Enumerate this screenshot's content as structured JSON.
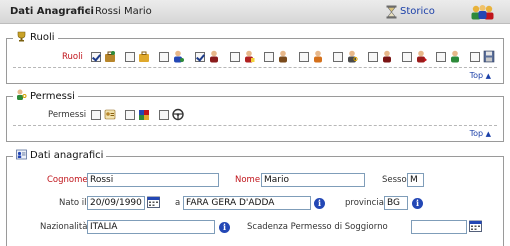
{
  "header": {
    "section_title": "Dati Anagrafici",
    "separator": "-",
    "person_name": "Rossi Mario",
    "storico_label": "Storico"
  },
  "ruoli": {
    "legend": "Ruoli",
    "row_label": "Ruoli",
    "top_label": "Top",
    "checkboxes": [
      true,
      false,
      false,
      false,
      true,
      false,
      false,
      false,
      false,
      false,
      false,
      false,
      false,
      false
    ],
    "icons": [
      "briefcase-icon",
      "briefcase-gold-icon",
      "person-blue-icon",
      "person-red-icon",
      "person-red-badge-icon",
      "person-brown-icon",
      "person-orange-icon",
      "person-key-icon",
      "person-dark-icon",
      "person-tie-icon",
      "person-heart-icon",
      "person-green-icon",
      "floppy-disk-icon"
    ]
  },
  "permessi": {
    "legend": "Permessi",
    "row_label": "Permessi",
    "top_label": "Top",
    "checkboxes": [
      false,
      false,
      false
    ],
    "icons": [
      "permit-card-icon",
      "puzzle-icon",
      "steering-wheel-icon"
    ]
  },
  "anagrafici": {
    "legend": "Dati anagrafici",
    "cognome_label": "Cognome",
    "cognome_value": "Rossi",
    "nome_label": "Nome",
    "nome_value": "Mario",
    "sesso_label": "Sesso",
    "sesso_value": "M",
    "nato_label": "Nato il",
    "nato_value": "20/09/1990",
    "a_label": "a",
    "luogo_value": "FARA GERA D'ADDA",
    "provincia_label": "provincia",
    "provincia_value": "BG",
    "nazionalita_label": "Nazionalità",
    "nazionalita_value": "ITALIA",
    "scadenza_label": "Scadenza Permesso di Soggiorno",
    "scadenza_value": ""
  },
  "colors": {
    "required_label": "#c0141b",
    "link": "#1a3fa8",
    "info": "#2347b5"
  }
}
